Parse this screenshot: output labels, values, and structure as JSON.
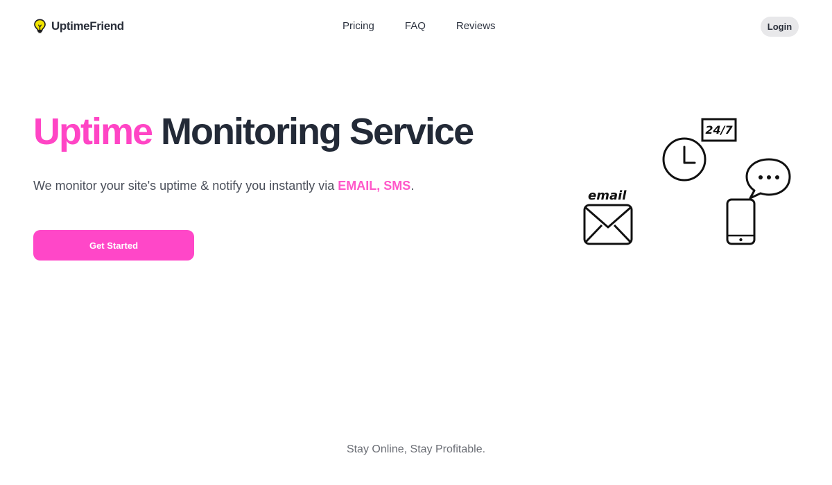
{
  "brand": {
    "name": "UptimeFriend",
    "icon": "lightbulb-icon",
    "icon_color": "#f2e500"
  },
  "nav": {
    "items": [
      {
        "label": "Pricing"
      },
      {
        "label": "FAQ"
      },
      {
        "label": "Reviews"
      }
    ]
  },
  "header": {
    "login_label": "Login"
  },
  "hero": {
    "title_accent": "Uptime",
    "title_rest": "Monitoring Service",
    "subtitle_prefix": "We monitor your site's uptime & notify you instantly via ",
    "subtitle_highlight": "EMAIL, SMS",
    "subtitle_suffix": ".",
    "cta_label": "Get Started"
  },
  "illustration": {
    "badge_text": "24/7",
    "email_label": "email",
    "icons": [
      "clock-icon",
      "envelope-icon",
      "chat-bubble-icon",
      "smartphone-icon"
    ]
  },
  "footer": {
    "tagline": "Stay Online, Stay Profitable."
  },
  "colors": {
    "accent": "#ff47c8",
    "text_dark": "#232a37",
    "login_bg": "#e8e8ea"
  }
}
